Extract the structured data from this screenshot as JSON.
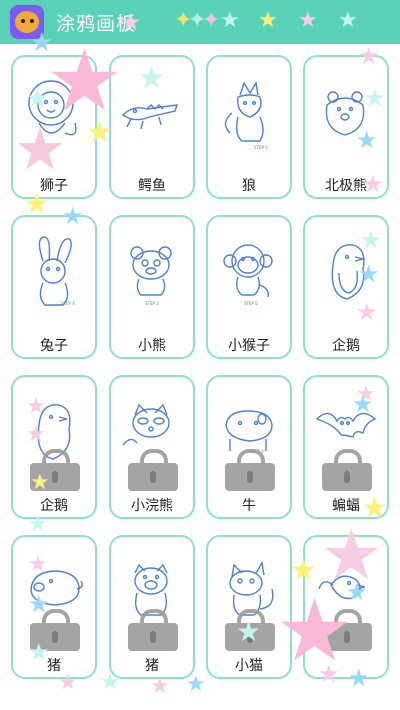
{
  "header": {
    "title": "涂鸦画板",
    "app_icon": "bear-app-icon",
    "colors": {
      "bar": "#5ad2b8"
    },
    "stars": [
      "rainbow-star-icon",
      "rainbow-star-icon",
      "rainbow-star-icon",
      "mint-star-icon",
      "yellow-star-icon",
      "pink-star-icon",
      "mint-star-icon"
    ]
  },
  "cards": [
    {
      "label": "狮子",
      "icon": "lion-drawing",
      "locked": false
    },
    {
      "label": "鳄鱼",
      "icon": "crocodile-drawing",
      "locked": false
    },
    {
      "label": "狼",
      "icon": "wolf-drawing",
      "locked": false
    },
    {
      "label": "北极熊",
      "icon": "polar-bear-drawing",
      "locked": false
    },
    {
      "label": "兔子",
      "icon": "rabbit-drawing",
      "locked": false
    },
    {
      "label": "小熊",
      "icon": "bear-drawing",
      "locked": false
    },
    {
      "label": "小猴子",
      "icon": "monkey-drawing",
      "locked": false
    },
    {
      "label": "企鹅",
      "icon": "penguin-drawing",
      "locked": false
    },
    {
      "label": "企鹅",
      "icon": "penguin-drawing",
      "locked": true
    },
    {
      "label": "小浣熊",
      "icon": "raccoon-drawing",
      "locked": true
    },
    {
      "label": "牛",
      "icon": "cow-drawing",
      "locked": true
    },
    {
      "label": "蝙蝠",
      "icon": "bat-drawing",
      "locked": true
    },
    {
      "label": "猪",
      "icon": "pig-drawing",
      "locked": true
    },
    {
      "label": "猪",
      "icon": "pig-drawing",
      "locked": true
    },
    {
      "label": "小猫",
      "icon": "cat-drawing",
      "locked": true
    },
    {
      "label": "",
      "icon": "bird-drawing",
      "locked": true
    }
  ],
  "decor": {
    "star_colors": [
      "#f9b8d8",
      "#bfeee6",
      "#fff07a",
      "#9ad8f6",
      "#c6f4ee"
    ]
  }
}
